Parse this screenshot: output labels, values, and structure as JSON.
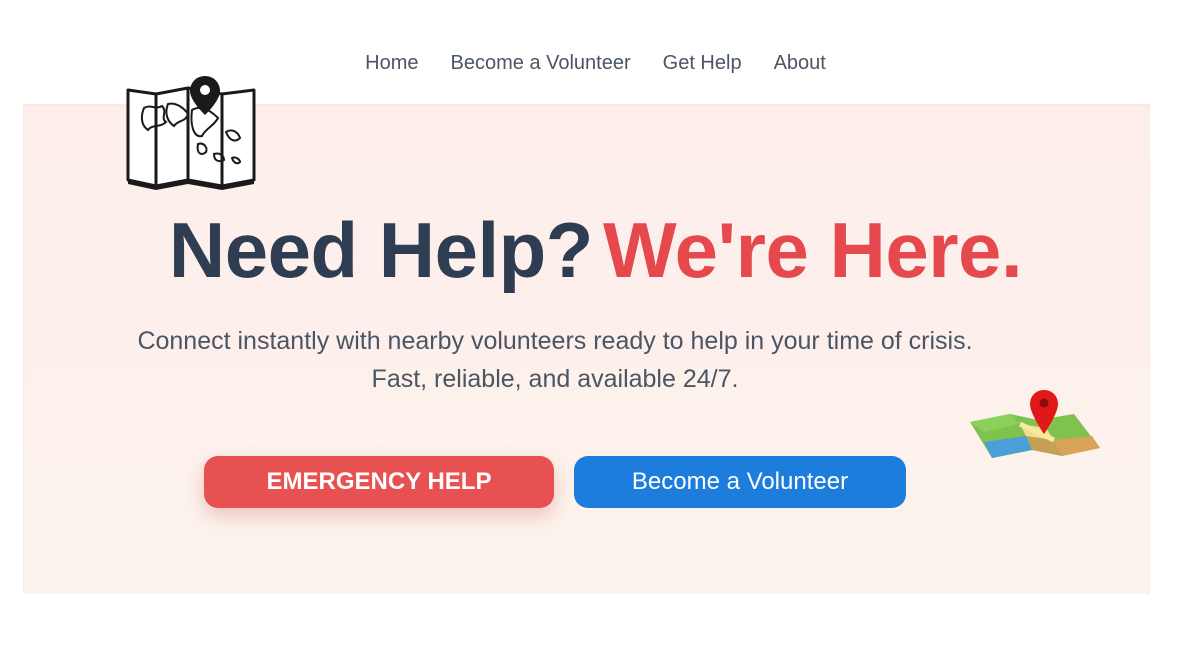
{
  "nav": {
    "items": [
      {
        "label": "Home"
      },
      {
        "label": "Become a Volunteer"
      },
      {
        "label": "Get Help"
      },
      {
        "label": "About"
      }
    ]
  },
  "hero": {
    "title_dark": "Need Help?",
    "title_red": "We're Here.",
    "subtitle": "Connect instantly with nearby volunteers ready to help in your time of crisis. Fast, reliable, and available 24/7.",
    "emergency_label": "EMERGENCY HELP",
    "volunteer_label": "Become a Volunteer"
  },
  "icons": {
    "top_left": "folded-map-pin-icon",
    "bottom_right": "color-map-pin-icon"
  },
  "colors": {
    "title_dark": "#2f3d52",
    "accent_red": "#e5484d",
    "emergency_button": "#e85152",
    "volunteer_button": "#1d7ddc",
    "nav_text": "#4b5563",
    "hero_bg": "#fdeeeb"
  }
}
